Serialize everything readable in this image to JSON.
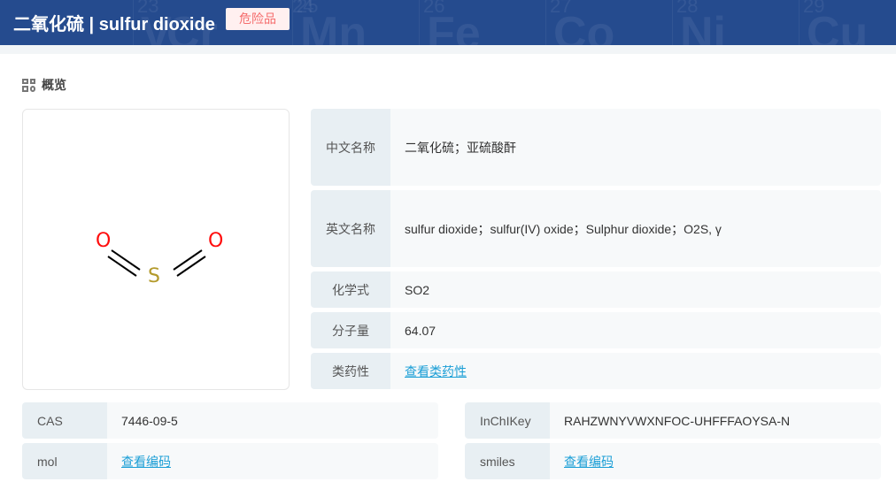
{
  "header": {
    "title": "二氧化硫 | sulfur dioxide",
    "badge": "危险品",
    "bg_elements": [
      {
        "n": "23",
        "s": "V"
      },
      {
        "n": "24",
        "s": "Cr"
      },
      {
        "n": "25",
        "s": "Mn"
      },
      {
        "n": "26",
        "s": "Fe"
      },
      {
        "n": "27",
        "s": "Co"
      },
      {
        "n": "28",
        "s": "Ni"
      },
      {
        "n": "29",
        "s": "Cu"
      }
    ]
  },
  "section": {
    "title": "概览",
    "icon": "grid-icon"
  },
  "structure": {
    "atoms": [
      "O",
      "S",
      "O"
    ]
  },
  "props": [
    {
      "k": "中文名称",
      "v": "二氧化硫；亚硫酸酐"
    },
    {
      "k": "英文名称",
      "v": "sulfur dioxide；sulfur(IV) oxide；Sulphur dioxide；O2S, γ"
    },
    {
      "k": "化学式",
      "v": "SO2"
    },
    {
      "k": "分子量",
      "v": "64.07"
    },
    {
      "k": "类药性",
      "v": "查看类药性"
    }
  ],
  "ids": [
    {
      "k": "CAS",
      "v": "7446-09-5"
    },
    {
      "k": "mol",
      "v": "查看编码"
    },
    {
      "k": "InChIKey",
      "v": "RAHZWNYVWXNFOC-UHFFFAOYSA-N"
    },
    {
      "k": "smiles",
      "v": "查看编码"
    }
  ],
  "colors": {
    "header": "#254b8e",
    "badge_text": "#f56c6c",
    "link": "#1a9ed6",
    "oxygen": "#ff0d0d",
    "sulfur": "#b39a2b"
  }
}
